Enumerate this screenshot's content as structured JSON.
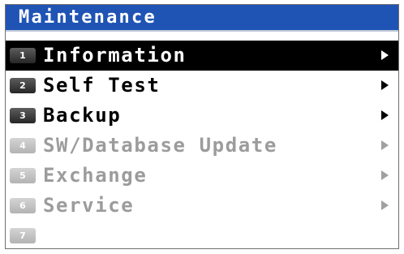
{
  "window": {
    "title": "Maintenance"
  },
  "menu": {
    "items": [
      {
        "number": "1",
        "label": "Information",
        "selected": true,
        "enabled": true,
        "submenu_icon": "right-triangle-icon"
      },
      {
        "number": "2",
        "label": "Self Test",
        "selected": false,
        "enabled": true,
        "submenu_icon": "right-triangle-icon"
      },
      {
        "number": "3",
        "label": "Backup",
        "selected": false,
        "enabled": true,
        "submenu_icon": "right-triangle-icon"
      },
      {
        "number": "4",
        "label": "SW/Database Update",
        "selected": false,
        "enabled": false,
        "submenu_icon": "right-triangle-icon"
      },
      {
        "number": "5",
        "label": "Exchange",
        "selected": false,
        "enabled": false,
        "submenu_icon": "right-triangle-icon"
      },
      {
        "number": "6",
        "label": "Service",
        "selected": false,
        "enabled": false,
        "submenu_icon": "right-triangle-icon"
      },
      {
        "number": "7",
        "label": "",
        "selected": false,
        "enabled": false,
        "submenu_icon": ""
      }
    ]
  },
  "colors": {
    "title_bar": "#1f54b4",
    "selected_row": "#000000",
    "enabled_text": "#000000",
    "disabled_text": "#9c9c9c",
    "number_badge_enabled": "#333333",
    "number_badge_disabled": "#c4c4c4"
  }
}
